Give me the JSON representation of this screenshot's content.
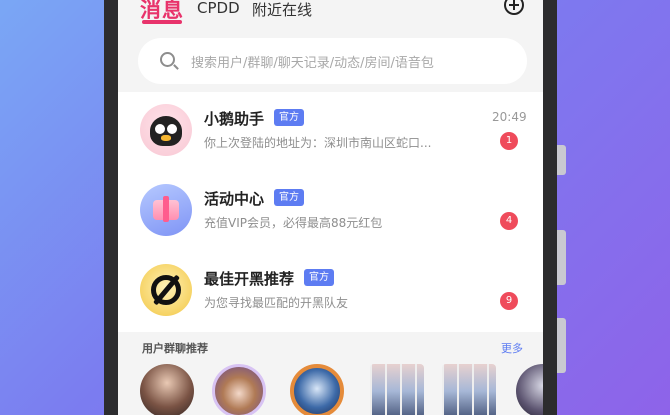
{
  "header": {
    "tabs": [
      {
        "label": "消息",
        "active": true
      },
      {
        "label": "CPDD",
        "active": false
      },
      {
        "label": "附近在线",
        "active": false
      }
    ],
    "add_icon": "plus-circle-icon"
  },
  "search": {
    "placeholder": "搜索用户/群聊/聊天记录/动态/房间/语音包",
    "icon": "search-icon"
  },
  "conversations": [
    {
      "name": "小鹅助手",
      "badge": "官方",
      "preview": "你上次登陆的地址为：深圳市南山区蛇口...",
      "time": "20:49",
      "unread": "1",
      "avatar": "penguin-avatar"
    },
    {
      "name": "活动中心",
      "badge": "官方",
      "preview": "充值VIP会员，必得最高88元红包",
      "time": "",
      "unread": "4",
      "avatar": "gift-avatar"
    },
    {
      "name": "最佳开黑推荐",
      "badge": "官方",
      "preview": "为您寻找最匹配的开黑队友",
      "time": "",
      "unread": "9",
      "avatar": "gaming-avatar"
    }
  ],
  "recommend": {
    "title": "用户群聊推荐",
    "more": "更多"
  },
  "colors": {
    "accent": "#e8336b",
    "badge": "#5d7cf2",
    "unread": "#ef4b5b"
  }
}
